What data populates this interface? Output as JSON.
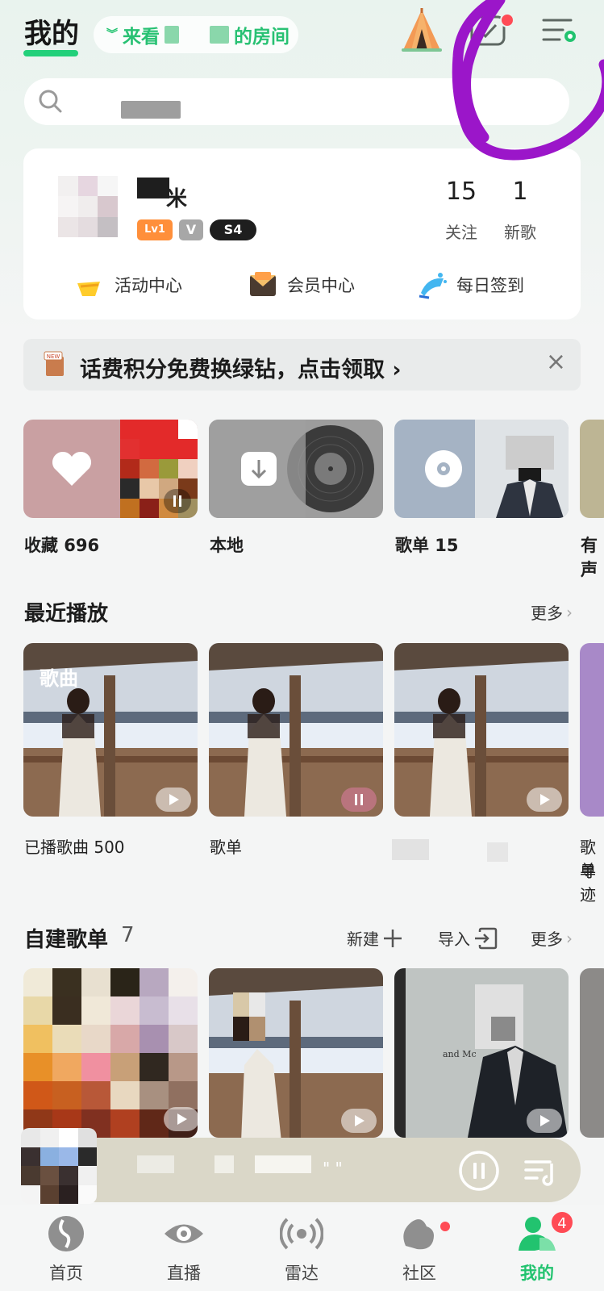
{
  "header": {
    "title": "我的",
    "room_pill_prefix": "来看",
    "room_pill_suffix": "的房间",
    "message_badge": "+"
  },
  "search": {
    "placeholder": ""
  },
  "profile": {
    "level_badge": "Lv1",
    "vip_badge": "V",
    "s_badge": "S4",
    "stats": [
      {
        "value": "15",
        "label": "关注"
      },
      {
        "value": "1",
        "label": "新歌"
      }
    ],
    "quick_links": [
      {
        "icon": "activity-icon",
        "label": "活动中心"
      },
      {
        "icon": "membership-icon",
        "label": "会员中心"
      },
      {
        "icon": "checkin-icon",
        "label": "每日签到"
      }
    ]
  },
  "banner": {
    "icon_text": "NEW",
    "text": "话费积分免费换绿钻，点击领取 ›",
    "close": "×"
  },
  "library_tiles": [
    {
      "label": "收藏 696",
      "icon": "heart-icon"
    },
    {
      "label": "本地",
      "icon": "download-icon"
    },
    {
      "label": "歌单 15",
      "icon": "disc-icon"
    },
    {
      "label": "有声",
      "icon": "audio-icon"
    }
  ],
  "recent": {
    "title": "最近播放",
    "more": "更多",
    "cover_tag": "歌曲",
    "items": [
      {
        "label": "已播歌曲 500"
      },
      {
        "label": "歌单"
      },
      {
        "label": ""
      },
      {
        "label": "歌单"
      },
      {
        "label": "寻迹"
      }
    ]
  },
  "playlists": {
    "title": "自建歌单",
    "count": "7",
    "new_label": "新建",
    "import_label": "导入",
    "more": "更多",
    "extra_text": "and Mc"
  },
  "player": {
    "title": "\" \""
  },
  "nav": {
    "items": [
      {
        "label": "首页",
        "icon": "home-icon"
      },
      {
        "label": "直播",
        "icon": "live-icon"
      },
      {
        "label": "雷达",
        "icon": "radar-icon"
      },
      {
        "label": "社区",
        "icon": "community-icon"
      },
      {
        "label": "我的",
        "icon": "profile-icon"
      }
    ],
    "badge": "4"
  },
  "colors": {
    "accent": "#22c36f",
    "badge": "#ff4b55",
    "annotation": "#9b16c9"
  }
}
